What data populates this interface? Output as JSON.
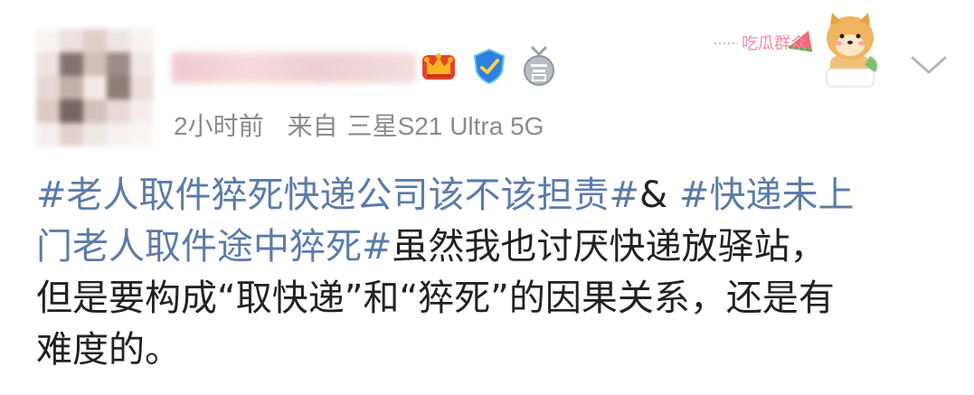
{
  "post": {
    "timestamp": "2小时前",
    "source_prefix": "来自",
    "device": "三星S21 Ultra 5G",
    "lines": [
      [
        {
          "text": "#老人取件猝死快递公司该不该担责#",
          "hashtag": true
        },
        {
          "text": "& ",
          "hashtag": false
        },
        {
          "text": "#快递未上",
          "hashtag": true
        }
      ],
      [
        {
          "text": "门老人取件途中猝死#",
          "hashtag": true
        },
        {
          "text": "虽然我也讨厌快递放驿站，",
          "hashtag": false
        }
      ],
      [
        {
          "text": "但是要构成“取快递”和“猝死”的因果关系，还是有",
          "hashtag": false
        }
      ],
      [
        {
          "text": "难度的。",
          "hashtag": false
        }
      ]
    ]
  },
  "sticker": {
    "text": "吃瓜群众"
  },
  "icons": {
    "crown": "crown-badge-icon",
    "verified": "blue-verified-badge-icon",
    "answer": "answer-badge-icon",
    "chevron": "chevron-down-icon"
  },
  "colors": {
    "hashtag": "#5b7ca8",
    "meta_text": "#8a8a8a",
    "body_text": "#222222",
    "sticker_text": "#f28ca0",
    "verified_blue": "#2f7fe0",
    "crown_red": "#e8412f",
    "crown_gold": "#f5b521"
  }
}
